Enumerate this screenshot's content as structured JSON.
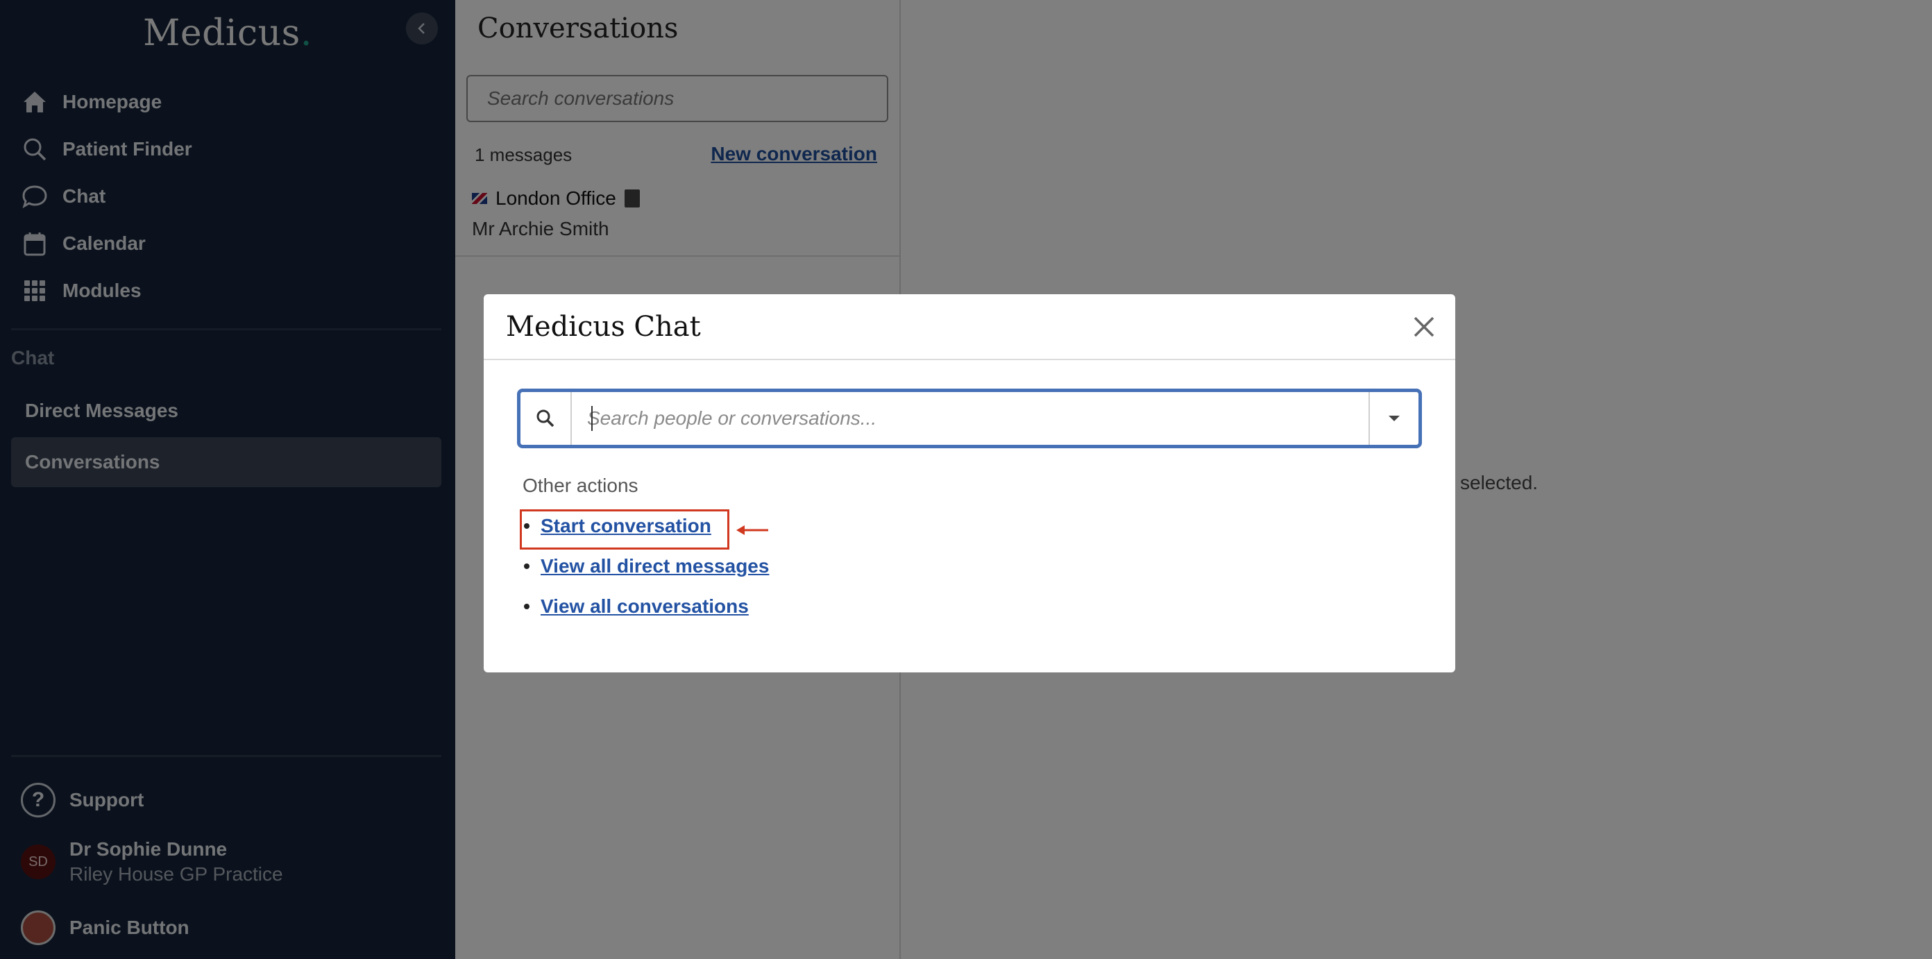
{
  "sidebar": {
    "logo": "Medicus",
    "logo_dot": ".",
    "nav": [
      {
        "label": "Homepage",
        "icon": "home-icon"
      },
      {
        "label": "Patient Finder",
        "icon": "search-icon"
      },
      {
        "label": "Chat",
        "icon": "chat-icon"
      },
      {
        "label": "Calendar",
        "icon": "calendar-icon"
      },
      {
        "label": "Modules",
        "icon": "grid-icon"
      }
    ],
    "section_label": "Chat",
    "sub_items": [
      {
        "label": "Direct Messages",
        "active": false
      },
      {
        "label": "Conversations",
        "active": true
      }
    ],
    "support": "Support",
    "user": {
      "initials": "SD",
      "name": "Dr Sophie Dunne",
      "org": "Riley House GP Practice"
    },
    "panic": "Panic Button"
  },
  "conversations": {
    "title": "Conversations",
    "search_placeholder": "Search conversations",
    "count": "1 messages",
    "new_label": "New conversation",
    "items": [
      {
        "title": "London Office",
        "subtitle": "Mr Archie Smith"
      }
    ]
  },
  "main": {
    "empty_text": "selected."
  },
  "modal": {
    "title": "Medicus Chat",
    "search_placeholder": "Search people or conversations...",
    "other_actions_label": "Other actions",
    "actions": [
      {
        "label": "Start conversation",
        "highlighted": true
      },
      {
        "label": "View all direct messages",
        "highlighted": false
      },
      {
        "label": "View all conversations",
        "highlighted": false
      }
    ]
  },
  "colors": {
    "sidebar_bg": "#16243a",
    "accent_link": "#2352a3",
    "highlight": "#d0381f",
    "search_border": "#4771b6"
  }
}
